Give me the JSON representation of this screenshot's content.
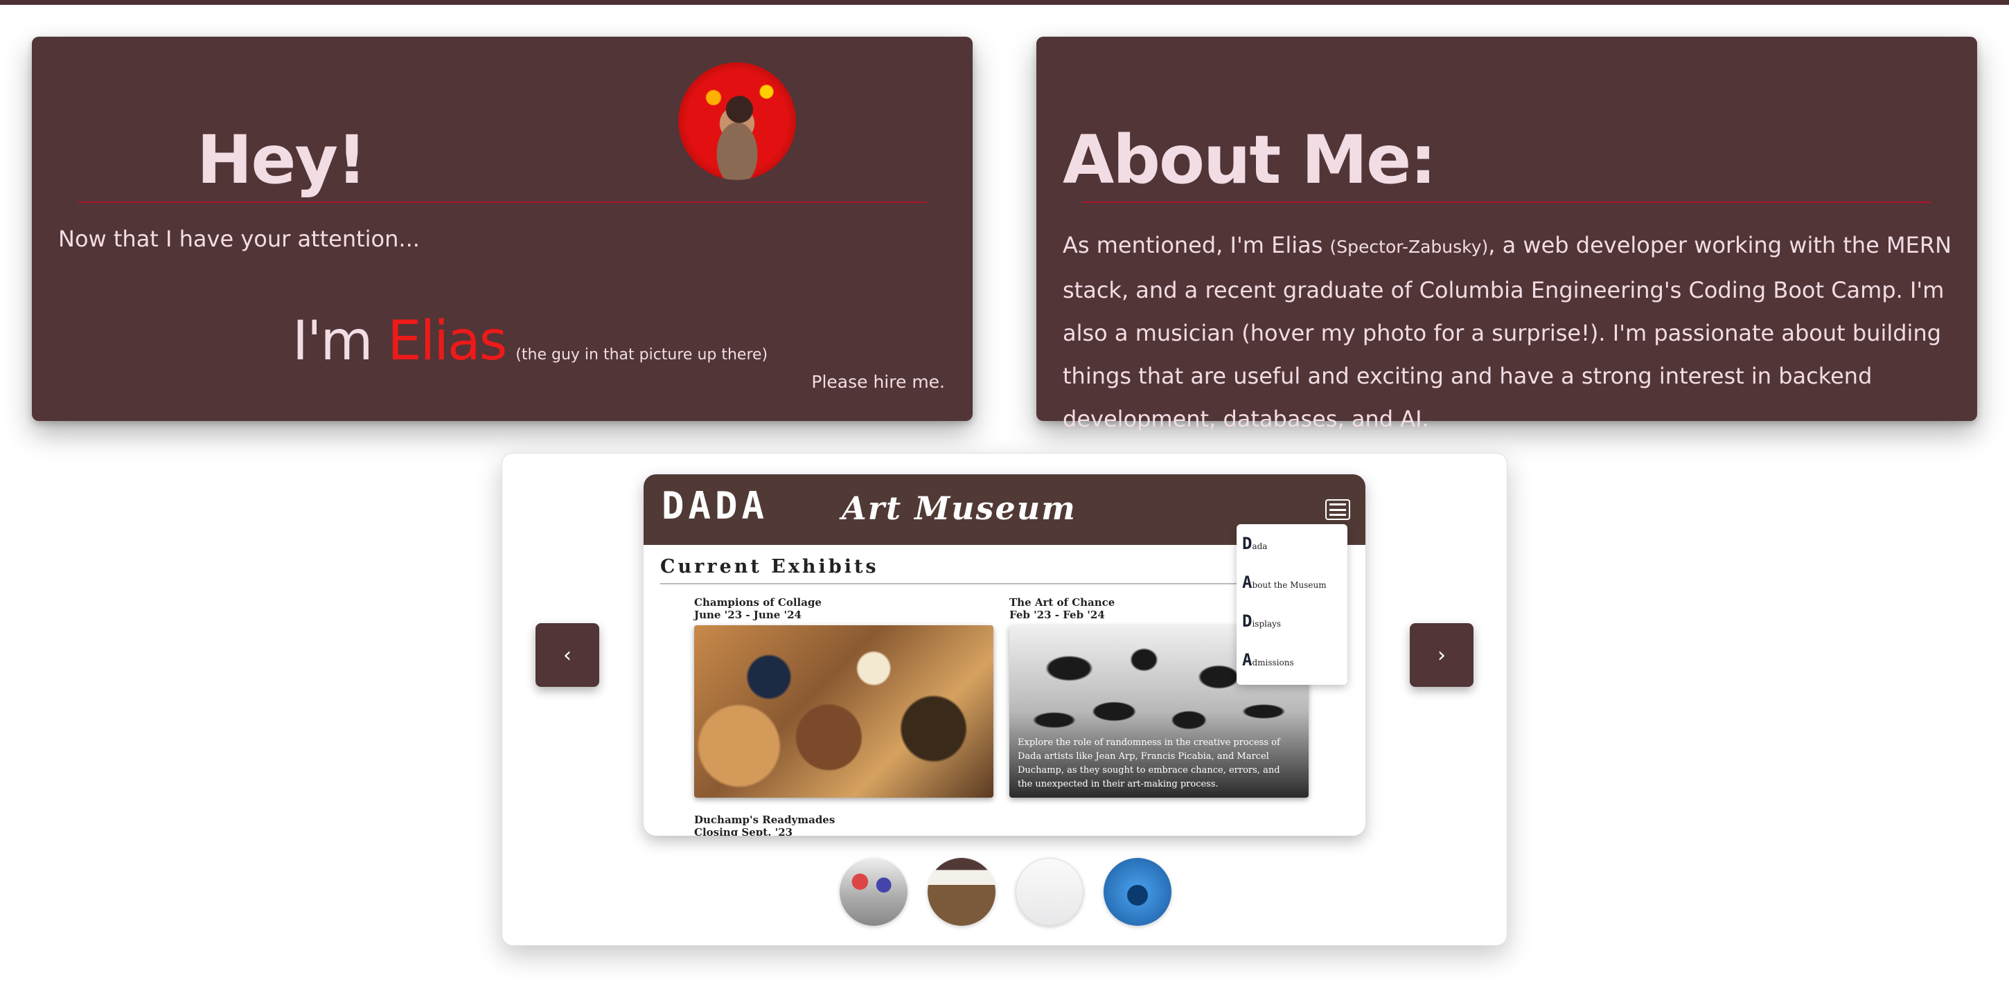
{
  "hey_card": {
    "title": "Hey!",
    "attention": "Now that I have your attention...",
    "im": "I'm ",
    "name": "Elias",
    "note": "(the guy in that picture up there)",
    "hire": "Please hire me."
  },
  "about_card": {
    "title": "About Me:",
    "text_before": "As mentioned, I'm Elias ",
    "text_small": "(Spector-Zabusky)",
    "text_after": ", a web developer working with the MERN stack, and a recent graduate of Columbia Engineering's Coding Boot Camp. I'm also a musician (hover my photo for a surprise!). I'm passionate about building things that are useful and exciting and have a strong interest in backend development, databases, and AI."
  },
  "carousel": {
    "prev_label": "‹",
    "next_label": "›",
    "slide": {
      "logo": "DADA",
      "title": "Art Museum",
      "section_heading": "Current Exhibits",
      "exhibits": [
        {
          "title": "Champions of Collage",
          "dates": "June '23 - June '24"
        },
        {
          "title": "The Art of Chance",
          "dates": "Feb '23 - Feb '24",
          "caption": "Explore the role of randomness in the creative process of Dada artists like Jean Arp, Francis Picabia, and Marcel Duchamp, as they sought to embrace chance, errors, and the unexpected in their art-making process."
        },
        {
          "title": "Duchamp's Readymades",
          "dates": "Closing Sept. '23"
        }
      ],
      "menu": [
        {
          "cap": "D",
          "rest": "ada"
        },
        {
          "cap": "A",
          "rest": "bout the Museum"
        },
        {
          "cap": "D",
          "rest": "isplays"
        },
        {
          "cap": "A",
          "rest": "dmissions"
        }
      ]
    }
  },
  "colors": {
    "card_bg": "#513537",
    "accent_red": "#ee1a1a",
    "rule_red": "#b0152a",
    "text_light": "#f1dde3"
  }
}
